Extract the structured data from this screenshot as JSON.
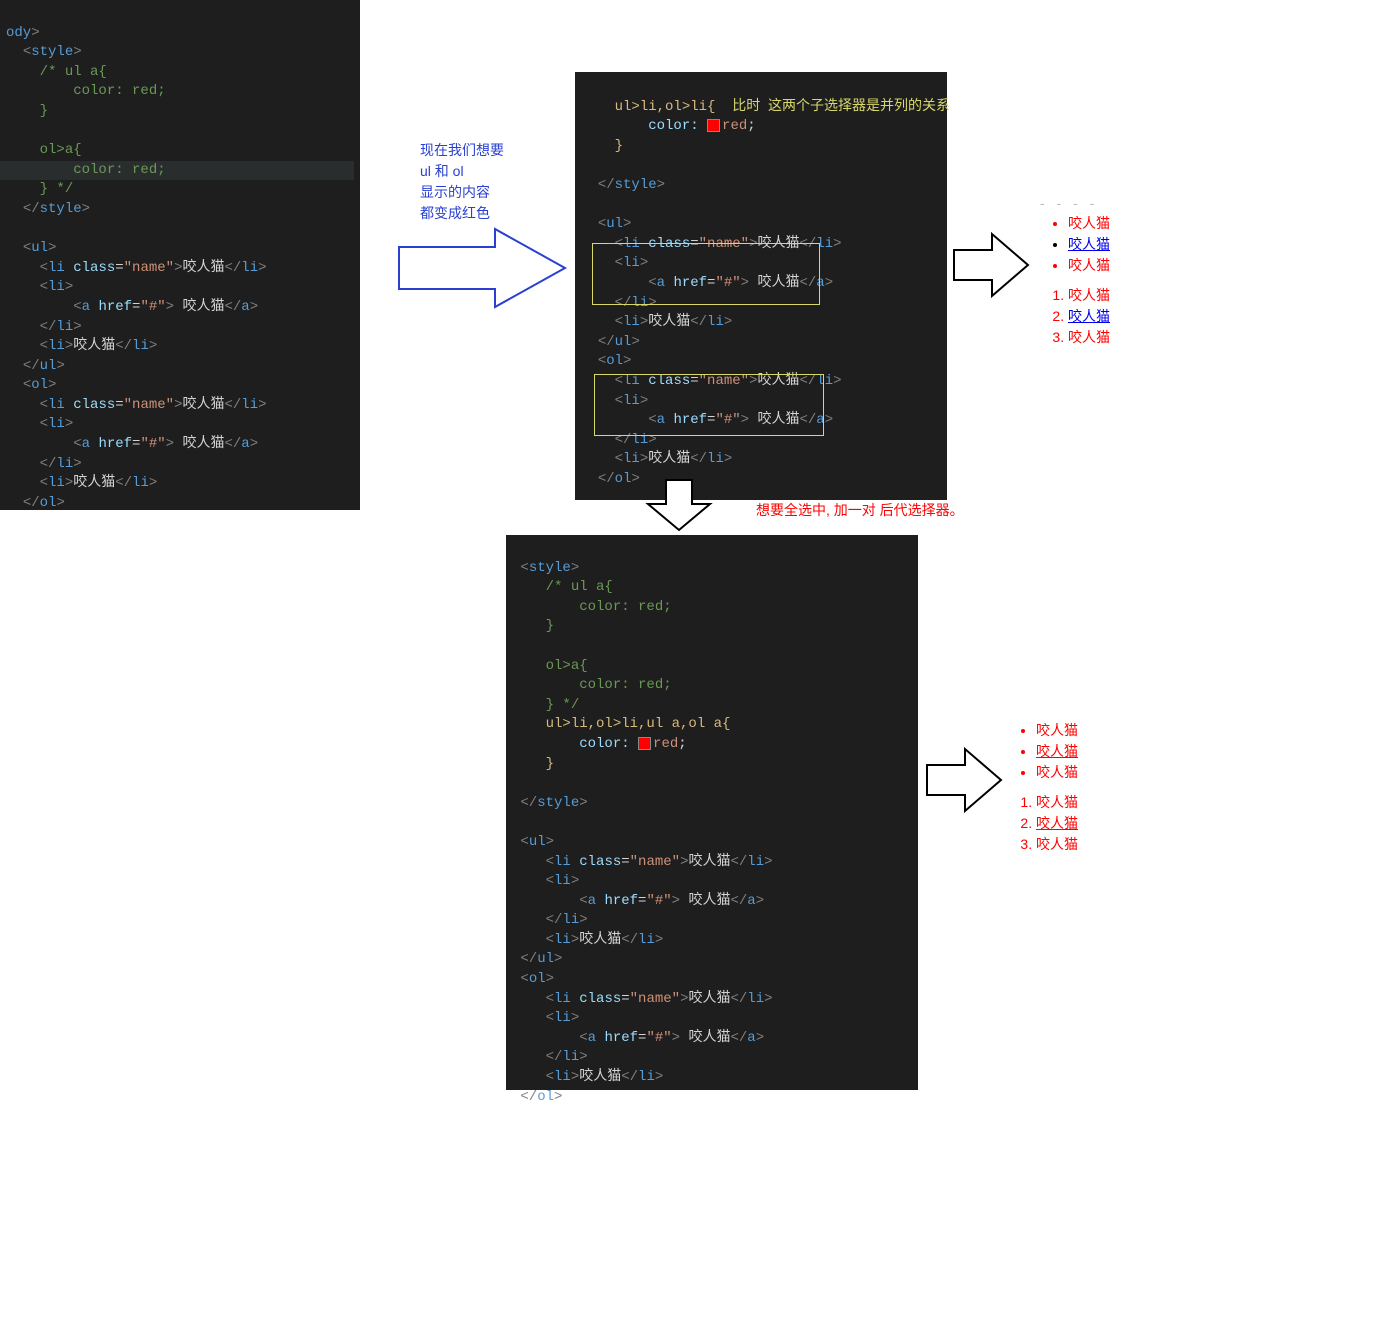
{
  "text": {
    "body": "ody",
    "open_style": "style",
    "close_style": "style",
    "open_ul": "ul",
    "close_ul": "ul",
    "open_ol": "ol",
    "close_ol": "ol",
    "open_li": "li",
    "close_li": "li",
    "open_a": "a",
    "close_a": "a",
    "attr_class": "class",
    "attr_href": "href",
    "val_name": "\"name\"",
    "val_hash": "\"#\"",
    "cat": "咬人猫",
    "space_cat": " 咬人猫",
    "css_comment_open": "/* ul a{",
    "css_color_red_line": "    color: red;",
    "css_color_red_line_short": "color: red;",
    "css_brace_close": "}",
    "css_ol_a": "ol>a{",
    "css_close_comment": "} */",
    "sel1": "ul>li,ol>li{",
    "sel2": "ul>li,ol>li,ul a,ol a{",
    "css_prop_color": "color:",
    "css_val_red": "red"
  },
  "notes": {
    "blue_text": "现在我们想要\nul 和 ol\n显示的内容\n都变成红色",
    "yellow_text": "比时  这两个子选择器是并列的关系",
    "red_text": "想要全选中, 加一对 后代选择器。"
  },
  "preview1": {
    "dots": "- - - -",
    "items_ul": [
      "咬人猫",
      "咬人猫",
      "咬人猫"
    ],
    "items_ol": [
      "咬人猫",
      "咬人猫",
      "咬人猫"
    ]
  },
  "preview2": {
    "items_ul": [
      "咬人猫",
      "咬人猫",
      "咬人猫"
    ],
    "items_ol": [
      "咬人猫",
      "咬人猫",
      "咬人猫"
    ]
  }
}
